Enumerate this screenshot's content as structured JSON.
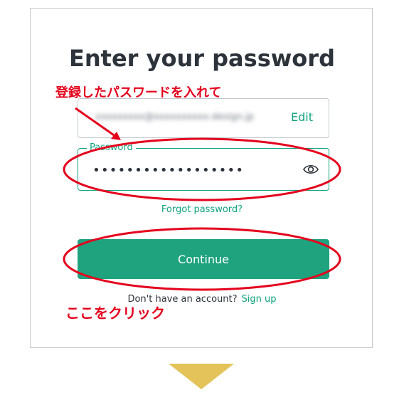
{
  "title": "Enter your password",
  "email": {
    "value": "xxxxxxxxx@xxxxxxxxxx-design.jp",
    "edit_label": "Edit"
  },
  "password": {
    "label": "Password",
    "value": "••••••••••••••••••",
    "toggle_icon": "eye-icon"
  },
  "forgot_label": "Forgot password?",
  "continue_label": "Continue",
  "signup": {
    "prompt": "Don't have an account?",
    "link_label": "Sign up"
  },
  "annotations": {
    "top_note": "登録したパスワードを入れて",
    "bottom_note": "ここをクリック"
  },
  "colors": {
    "accent": "#10a37f",
    "button": "#1fa37f",
    "annotation_red": "#e4001c",
    "arrow_gold": "#e3c35a"
  }
}
